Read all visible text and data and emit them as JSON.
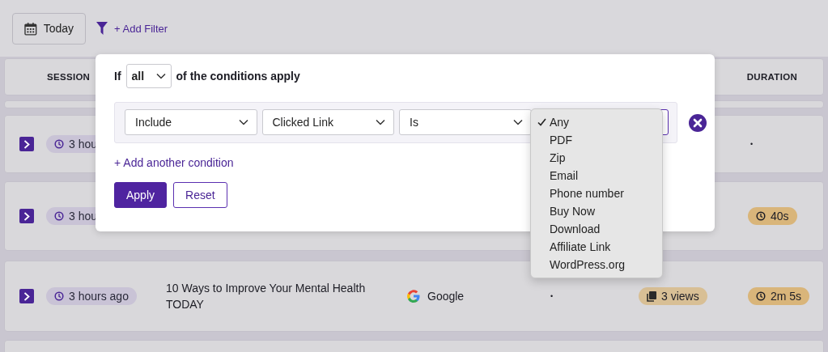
{
  "toolbar": {
    "date_button": "Today",
    "add_filter": "+ Add Filter"
  },
  "table": {
    "columns": [
      "SESSION",
      "DURATION"
    ],
    "rows": [
      {
        "time": "3 hou",
        "duration": {
          "kind": "plain",
          "text": "•"
        }
      },
      {
        "time": "3 hou",
        "duration": {
          "kind": "badge",
          "text": "40s"
        }
      },
      {
        "time": "3 hours ago",
        "page": "10 Ways to Improve Your Mental Health TODAY",
        "source": "Google",
        "column_4": "•",
        "views": "3 views",
        "duration": {
          "kind": "badge",
          "text": "2m 5s"
        }
      }
    ]
  },
  "filter_popover": {
    "prefix": "If",
    "match_select": "all",
    "suffix": "of the conditions apply",
    "condition": {
      "selects": [
        "Include",
        "Clicked Link",
        "Is"
      ]
    },
    "add_condition": "+ Add another condition",
    "buttons": [
      {
        "label": "Apply",
        "kind": "primary"
      },
      {
        "label": "Reset",
        "kind": "secondary"
      }
    ]
  },
  "dropdown": {
    "options": [
      {
        "label": "Any",
        "selected": true
      },
      {
        "label": "PDF",
        "selected": false
      },
      {
        "label": "Zip",
        "selected": false
      },
      {
        "label": "Email",
        "selected": false
      },
      {
        "label": "Phone number",
        "selected": false
      },
      {
        "label": "Buy Now",
        "selected": false
      },
      {
        "label": "Download",
        "selected": false
      },
      {
        "label": "Affiliate Link",
        "selected": false
      },
      {
        "label": "WordPress.org",
        "selected": false
      }
    ]
  }
}
